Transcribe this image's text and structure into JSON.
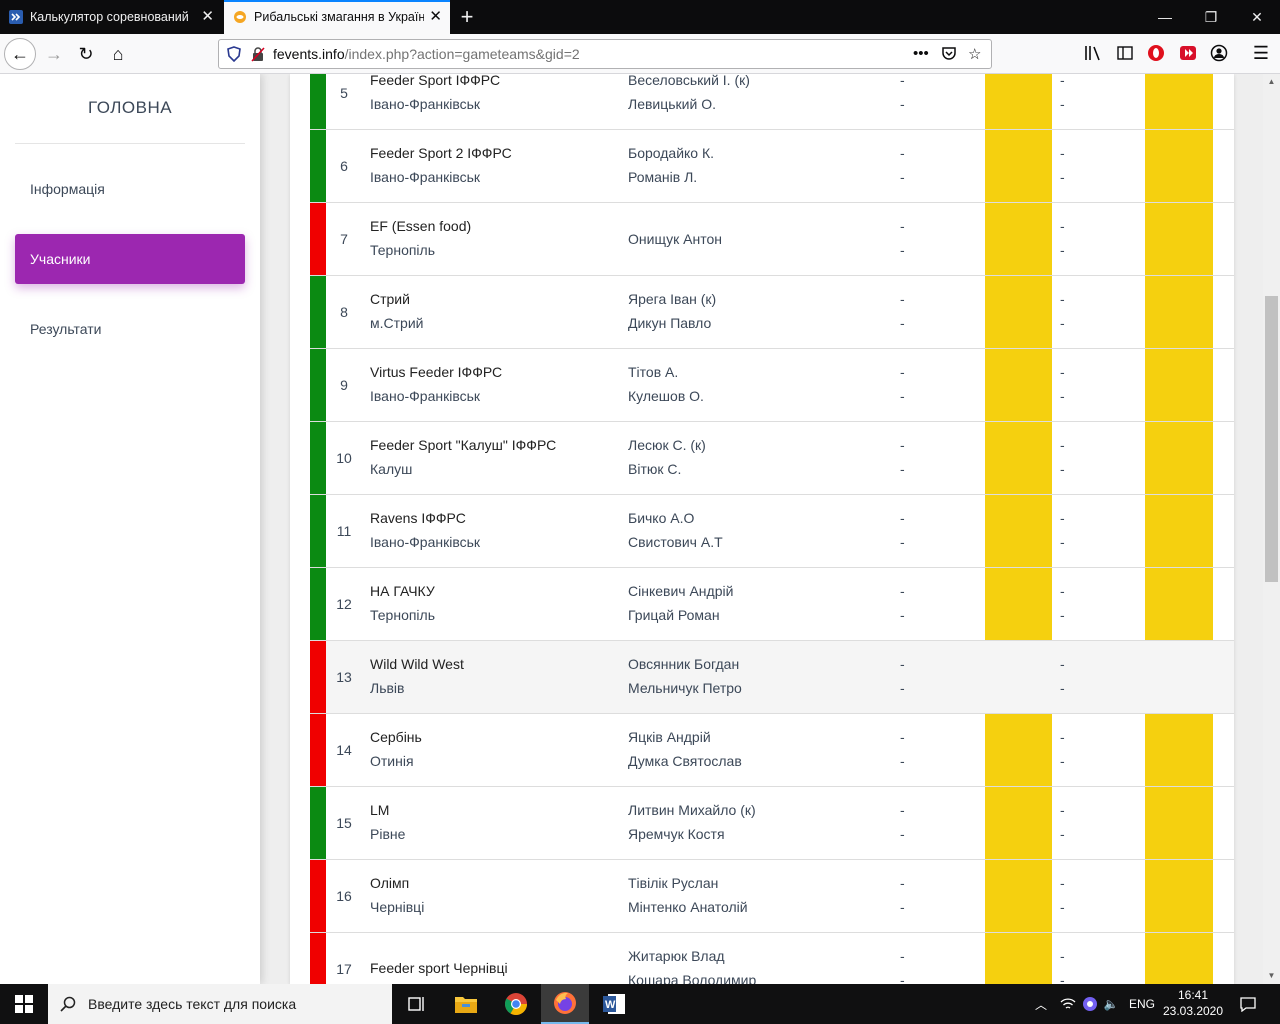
{
  "browser": {
    "tabs": [
      {
        "title": "Калькулятор соревнований fe",
        "active": false
      },
      {
        "title": "Рибальські змагання в Україні",
        "active": true
      }
    ],
    "url_host": "fevents.info",
    "url_rest": "/index.php?action=gameteams&gid=2"
  },
  "sidebar": {
    "title": "ГОЛОВНА",
    "items": [
      {
        "label": "Інформація",
        "active": false
      },
      {
        "label": "Учасники",
        "active": true
      },
      {
        "label": "Результати",
        "active": false
      }
    ]
  },
  "colors": {
    "green": "#0b8a12",
    "red": "#f00000",
    "yellow": "#f5d00f",
    "accent": "#9c27b0"
  },
  "teams": [
    {
      "num": "5",
      "status": "green",
      "team": "Feeder Sport ІФФРС",
      "city": "Івано-Франківськ",
      "players": [
        "Веселовський І. (к)",
        "Левицький О."
      ]
    },
    {
      "num": "6",
      "status": "green",
      "team": "Feeder Sport 2 ІФФРС",
      "city": "Івано-Франківськ",
      "players": [
        "Бородайко К.",
        "Романів Л."
      ]
    },
    {
      "num": "7",
      "status": "red",
      "team": "EF (Essen food)",
      "city": "Тернопіль",
      "players": [
        "Онищук Антон"
      ]
    },
    {
      "num": "8",
      "status": "green",
      "team": "Стрий",
      "city": "м.Стрий",
      "players": [
        "Ярега Іван (к)",
        "Дикун Павло"
      ]
    },
    {
      "num": "9",
      "status": "green",
      "team": "Virtus Feeder ІФФРС",
      "city": "Івано-Франківськ",
      "players": [
        "Тітов А.",
        "Кулешов О."
      ]
    },
    {
      "num": "10",
      "status": "green",
      "team": "Feeder Sport \"Калуш\" ІФФРС",
      "city": "Калуш",
      "players": [
        "Лесюк С. (к)",
        "Вітюк С."
      ]
    },
    {
      "num": "11",
      "status": "green",
      "team": "Ravens ІФФРС",
      "city": "Івано-Франківськ",
      "players": [
        "Бичко А.О",
        "Свистович А.Т"
      ]
    },
    {
      "num": "12",
      "status": "green",
      "team": "НА ГАЧКУ",
      "city": "Тернопіль",
      "players": [
        "Сінкевич Андрій",
        "Грицай Роман"
      ]
    },
    {
      "num": "13",
      "status": "red",
      "team": "Wild Wild West",
      "city": "Львів",
      "players": [
        "Овсянник Богдан",
        "Мельничук Петро"
      ],
      "highlight": true
    },
    {
      "num": "14",
      "status": "red",
      "team": "Сербінь",
      "city": "Отинія",
      "players": [
        "Яцків Андрій",
        "Думка Святослав"
      ]
    },
    {
      "num": "15",
      "status": "green",
      "team": "LM",
      "city": "Рівне",
      "players": [
        "Литвин Михайло (к)",
        "Яремчук Костя"
      ]
    },
    {
      "num": "16",
      "status": "red",
      "team": "Олімп",
      "city": "Чернівці",
      "players": [
        "Тівілік Руслан",
        "Мінтенко Анатолій"
      ]
    },
    {
      "num": "17",
      "status": "red",
      "team": "Feeder sport Чернівці",
      "city": "",
      "players": [
        "Житарюк Влад",
        "Кошара Володимир"
      ]
    }
  ],
  "dash": "-",
  "taskbar": {
    "search_placeholder": "Введите здесь текст для поиска",
    "lang": "ENG",
    "time": "16:41",
    "date": "23.03.2020"
  }
}
